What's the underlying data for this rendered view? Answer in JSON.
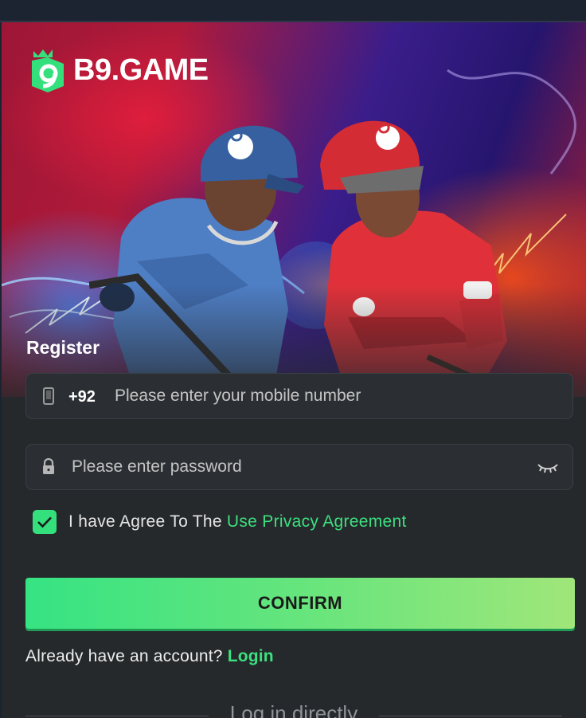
{
  "brand": {
    "name": "B9.GAME",
    "accent": "#34e07c",
    "logo_icon": "b9-crown-logo-icon"
  },
  "hero": {
    "image": "baseball-players-banner"
  },
  "register": {
    "title": "Register",
    "phone": {
      "icon": "mobile-phone-icon",
      "prefix": "+92",
      "placeholder": "Please enter your mobile number",
      "value": ""
    },
    "password": {
      "icon": "lock-icon",
      "placeholder": "Please enter password",
      "value": "",
      "toggle_icon": "eye-closed-icon"
    },
    "agreement": {
      "checked": true,
      "text": "I have Agree To The",
      "link": "Use Privacy Agreement"
    },
    "confirm_label": "CONFIRM",
    "login_prompt": "Already have an account?",
    "login_link": "Login",
    "direct_login": "Log in directly"
  }
}
